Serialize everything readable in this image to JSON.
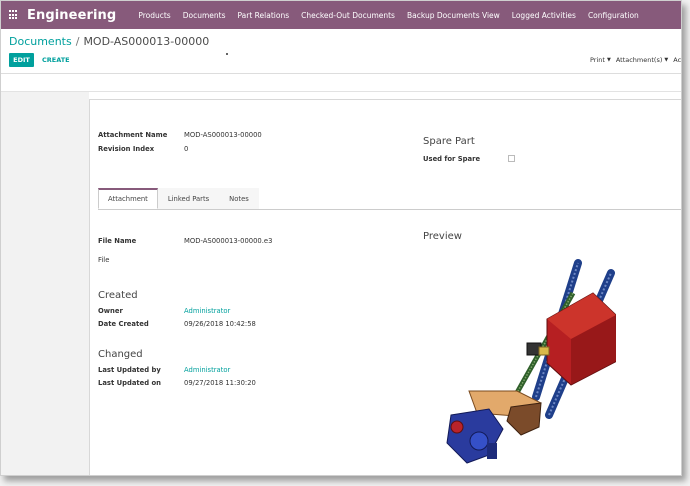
{
  "app": {
    "brand": "Engineering",
    "menu": [
      "Products",
      "Documents",
      "Part Relations",
      "Checked-Out Documents",
      "Backup Documents View",
      "Logged Activities",
      "Configuration"
    ]
  },
  "breadcrumb": {
    "parent": "Documents",
    "separator": "/",
    "current": "MOD-AS000013-00000"
  },
  "buttons": {
    "edit": "EDIT",
    "create": "CREATE"
  },
  "actions": {
    "print": "Print",
    "attachments": "Attachment(s)",
    "more": "Ac"
  },
  "form": {
    "attachment_name_label": "Attachment Name",
    "attachment_name": "MOD-AS000013-00000",
    "revision_label": "Revision Index",
    "revision": "0",
    "spare_title": "Spare Part",
    "used_for_spare_label": "Used for Spare",
    "used_for_spare": false
  },
  "tabs": [
    "Attachment",
    "Linked Parts",
    "Notes"
  ],
  "active_tab": "Attachment",
  "attachment": {
    "file_name_label": "File Name",
    "file_name": "MOD-AS000013-00000.e3",
    "file_label": "File",
    "preview_title": "Preview",
    "created_title": "Created",
    "owner_label": "Owner",
    "owner": "Administrator",
    "date_created_label": "Date Created",
    "date_created": "09/26/2018 10:42:58",
    "changed_title": "Changed",
    "last_updated_by_label": "Last Updated by",
    "last_updated_by": "Administrator",
    "last_updated_on_label": "Last Updated on",
    "last_updated_on": "09/27/2018 11:30:20"
  },
  "colors": {
    "brand": "#875a7b",
    "accent": "#00a09d"
  }
}
